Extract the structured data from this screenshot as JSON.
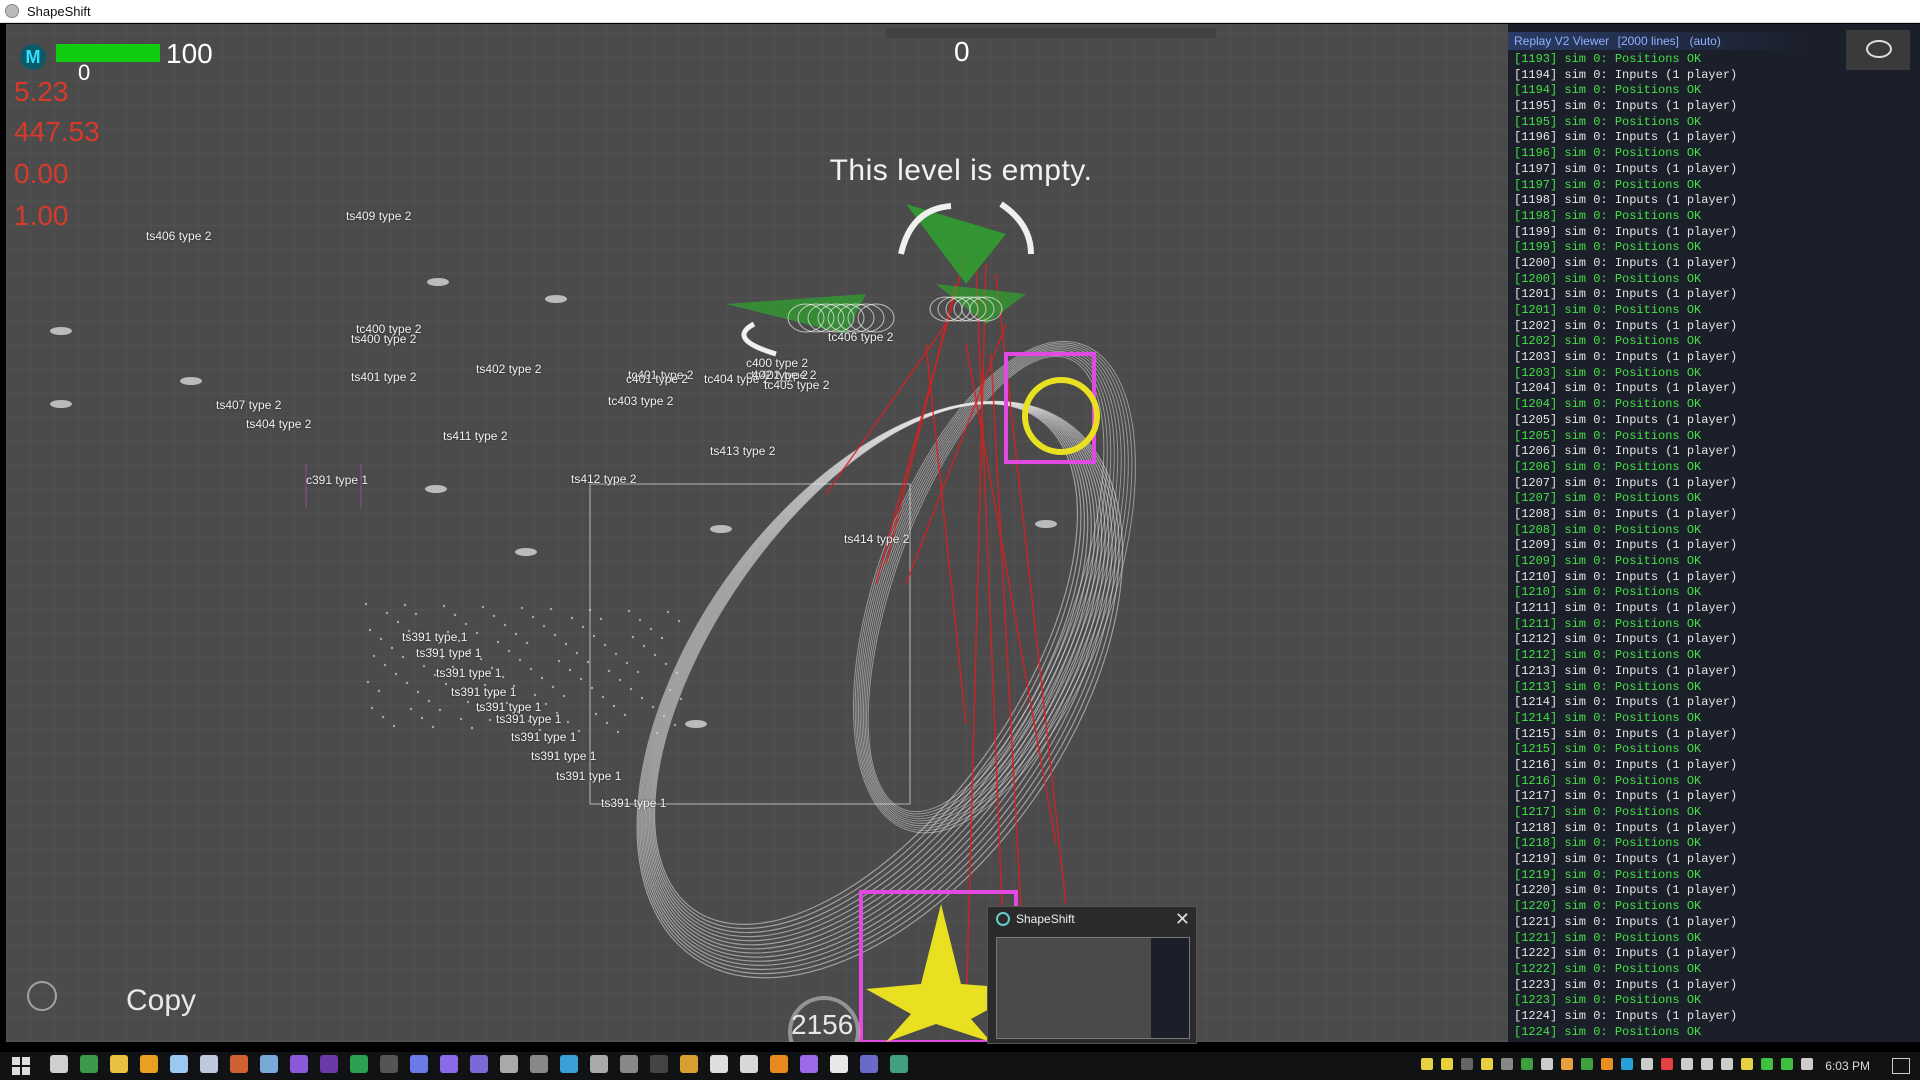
{
  "window": {
    "title": "ShapeShift"
  },
  "hud": {
    "logo": "M",
    "health": "100",
    "health_fraction": 1.0,
    "sub_value": "0",
    "stats": [
      "5.23",
      "447.53",
      "0.00",
      "1.00"
    ],
    "score": "0",
    "message": "This level is empty."
  },
  "scene_labels": [
    "ts409 type 2",
    "ts406 type 2",
    "ts400 type 2",
    "ts402 type 2",
    "ts401 type 2",
    "tc400 type 2",
    "tc406 type 2",
    "tc402 type 2",
    "tc401 type 2",
    "tc403 type 2",
    "tc404 type 2",
    "ts407 type 2",
    "ts404 type 2",
    "ts411 type 2",
    "ts412 type 2",
    "ts413 type 2",
    "ts414 type 2",
    "tc405 type 2",
    "c400 type 2",
    "c402 type 2",
    "c401 type 2",
    "c391 type 1",
    "ts391 type 1",
    "ts391 type 1",
    "ts391 type 1",
    "ts391 type 1",
    "ts391 type 1",
    "ts391 type 1",
    "ts391 type 1",
    "ts391 type 1",
    "ts391 type 1",
    "ts391 type 1"
  ],
  "bottom": {
    "copy_label": "Copy",
    "counter": "2156"
  },
  "log": {
    "title": "Replay V2 Viewer",
    "line_count": "[2000 lines]",
    "mode": "(auto)",
    "lines": [
      {
        "text": "[1193] sim 0: Positions OK",
        "kind": "ok"
      },
      {
        "text": "[1194] sim 0: Inputs (1 player)",
        "kind": "in"
      },
      {
        "text": "[1194] sim 0: Positions OK",
        "kind": "ok"
      },
      {
        "text": "[1195] sim 0: Inputs (1 player)",
        "kind": "in"
      },
      {
        "text": "[1195] sim 0: Positions OK",
        "kind": "ok"
      },
      {
        "text": "[1196] sim 0: Inputs (1 player)",
        "kind": "in"
      },
      {
        "text": "[1196] sim 0: Positions OK",
        "kind": "ok"
      },
      {
        "text": "[1197] sim 0: Inputs (1 player)",
        "kind": "in"
      },
      {
        "text": "[1197] sim 0: Positions OK",
        "kind": "ok"
      },
      {
        "text": "[1198] sim 0: Inputs (1 player)",
        "kind": "in"
      },
      {
        "text": "[1198] sim 0: Positions OK",
        "kind": "ok"
      },
      {
        "text": "[1199] sim 0: Inputs (1 player)",
        "kind": "in"
      },
      {
        "text": "[1199] sim 0: Positions OK",
        "kind": "ok"
      },
      {
        "text": "[1200] sim 0: Inputs (1 player)",
        "kind": "in"
      },
      {
        "text": "[1200] sim 0: Positions OK",
        "kind": "ok"
      },
      {
        "text": "[1201] sim 0: Inputs (1 player)",
        "kind": "in"
      },
      {
        "text": "[1201] sim 0: Positions OK",
        "kind": "ok"
      },
      {
        "text": "[1202] sim 0: Inputs (1 player)",
        "kind": "in"
      },
      {
        "text": "[1202] sim 0: Positions OK",
        "kind": "ok"
      },
      {
        "text": "[1203] sim 0: Inputs (1 player)",
        "kind": "in"
      },
      {
        "text": "[1203] sim 0: Positions OK",
        "kind": "ok"
      },
      {
        "text": "[1204] sim 0: Inputs (1 player)",
        "kind": "in"
      },
      {
        "text": "[1204] sim 0: Positions OK",
        "kind": "ok"
      },
      {
        "text": "[1205] sim 0: Inputs (1 player)",
        "kind": "in"
      },
      {
        "text": "[1205] sim 0: Positions OK",
        "kind": "ok"
      },
      {
        "text": "[1206] sim 0: Inputs (1 player)",
        "kind": "in"
      },
      {
        "text": "[1206] sim 0: Positions OK",
        "kind": "ok"
      },
      {
        "text": "[1207] sim 0: Inputs (1 player)",
        "kind": "in"
      },
      {
        "text": "[1207] sim 0: Positions OK",
        "kind": "ok"
      },
      {
        "text": "[1208] sim 0: Inputs (1 player)",
        "kind": "in"
      },
      {
        "text": "[1208] sim 0: Positions OK",
        "kind": "ok"
      },
      {
        "text": "[1209] sim 0: Inputs (1 player)",
        "kind": "in"
      },
      {
        "text": "[1209] sim 0: Positions OK",
        "kind": "ok"
      },
      {
        "text": "[1210] sim 0: Inputs (1 player)",
        "kind": "in"
      },
      {
        "text": "[1210] sim 0: Positions OK",
        "kind": "ok"
      },
      {
        "text": "[1211] sim 0: Inputs (1 player)",
        "kind": "in"
      },
      {
        "text": "[1211] sim 0: Positions OK",
        "kind": "ok"
      },
      {
        "text": "[1212] sim 0: Inputs (1 player)",
        "kind": "in"
      },
      {
        "text": "[1212] sim 0: Positions OK",
        "kind": "ok"
      },
      {
        "text": "[1213] sim 0: Inputs (1 player)",
        "kind": "in"
      },
      {
        "text": "[1213] sim 0: Positions OK",
        "kind": "ok"
      },
      {
        "text": "[1214] sim 0: Inputs (1 player)",
        "kind": "in"
      },
      {
        "text": "[1214] sim 0: Positions OK",
        "kind": "ok"
      },
      {
        "text": "[1215] sim 0: Inputs (1 player)",
        "kind": "in"
      },
      {
        "text": "[1215] sim 0: Positions OK",
        "kind": "ok"
      },
      {
        "text": "[1216] sim 0: Inputs (1 player)",
        "kind": "in"
      },
      {
        "text": "[1216] sim 0: Positions OK",
        "kind": "ok"
      },
      {
        "text": "[1217] sim 0: Inputs (1 player)",
        "kind": "in"
      },
      {
        "text": "[1217] sim 0: Positions OK",
        "kind": "ok"
      },
      {
        "text": "[1218] sim 0: Inputs (1 player)",
        "kind": "in"
      },
      {
        "text": "[1218] sim 0: Positions OK",
        "kind": "ok"
      },
      {
        "text": "[1219] sim 0: Inputs (1 player)",
        "kind": "in"
      },
      {
        "text": "[1219] sim 0: Positions OK",
        "kind": "ok"
      },
      {
        "text": "[1220] sim 0: Inputs (1 player)",
        "kind": "in"
      },
      {
        "text": "[1220] sim 0: Positions OK",
        "kind": "ok"
      },
      {
        "text": "[1221] sim 0: Inputs (1 player)",
        "kind": "in"
      },
      {
        "text": "[1221] sim 0: Positions OK",
        "kind": "ok"
      },
      {
        "text": "[1222] sim 0: Inputs (1 player)",
        "kind": "in"
      },
      {
        "text": "[1222] sim 0: Positions OK",
        "kind": "ok"
      },
      {
        "text": "[1223] sim 0: Inputs (1 player)",
        "kind": "in"
      },
      {
        "text": "[1223] sim 0: Positions OK",
        "kind": "ok"
      },
      {
        "text": "[1224] sim 0: Inputs (1 player)",
        "kind": "in"
      },
      {
        "text": "[1224] sim 0: Positions OK",
        "kind": "ok"
      }
    ]
  },
  "popup": {
    "title": "ShapeShift",
    "close": "✕"
  },
  "taskbar": {
    "apps": [
      {
        "name": "task-view-icon",
        "color": "#cfcfcf"
      },
      {
        "name": "chrome-icon",
        "color": "#3a9a4a"
      },
      {
        "name": "file-explorer-icon",
        "color": "#e8c040"
      },
      {
        "name": "media-player-icon",
        "color": "#e8a020"
      },
      {
        "name": "notepad-icon",
        "color": "#9ac8f0"
      },
      {
        "name": "document-icon",
        "color": "#c0c8e0"
      },
      {
        "name": "browser-icon",
        "color": "#d06030"
      },
      {
        "name": "steam-icon",
        "color": "#7aa8d8"
      },
      {
        "name": "visual-studio-icon",
        "color": "#8a5ad8"
      },
      {
        "name": "vs-code-icon",
        "color": "#6a3aa8"
      },
      {
        "name": "spreadsheet-icon",
        "color": "#2aa050"
      },
      {
        "name": "terminal-icon",
        "color": "#555555"
      },
      {
        "name": "discord-icon",
        "color": "#6a7ae8"
      },
      {
        "name": "app-icon",
        "color": "#8a6ae8"
      },
      {
        "name": "app-icon",
        "color": "#7a6ad8"
      },
      {
        "name": "unity-icon",
        "color": "#aaaaaa"
      },
      {
        "name": "app-icon",
        "color": "#888888"
      },
      {
        "name": "app-icon",
        "color": "#3aa0d8"
      },
      {
        "name": "app-icon",
        "color": "#aaaaaa"
      },
      {
        "name": "app-icon",
        "color": "#888888"
      },
      {
        "name": "app-icon",
        "color": "#444444"
      },
      {
        "name": "git-icon",
        "color": "#d8a030"
      },
      {
        "name": "clock-app-icon",
        "color": "#dddddd"
      },
      {
        "name": "pen-icon",
        "color": "#d8d8d8"
      },
      {
        "name": "vlc-icon",
        "color": "#e88a20"
      },
      {
        "name": "app-icon",
        "color": "#9a6ae8"
      },
      {
        "name": "app-icon",
        "color": "#e8e8e8"
      },
      {
        "name": "app-icon",
        "color": "#6a6ac8"
      },
      {
        "name": "shapeshift-icon",
        "color": "#40a080"
      }
    ],
    "tray": [
      "#e8d040",
      "#e8d040",
      "#666666",
      "#e8d040",
      "#888888",
      "#40a040",
      "#cccccc",
      "#e8a040",
      "#40a040",
      "#e89020",
      "#2aa0d8",
      "#cccccc",
      "#e84040",
      "#cccccc",
      "#cccccc",
      "#cccccc",
      "#e8d040",
      "#40c040",
      "#40c040",
      "#cccccc"
    ],
    "clock": "6:03 PM"
  }
}
